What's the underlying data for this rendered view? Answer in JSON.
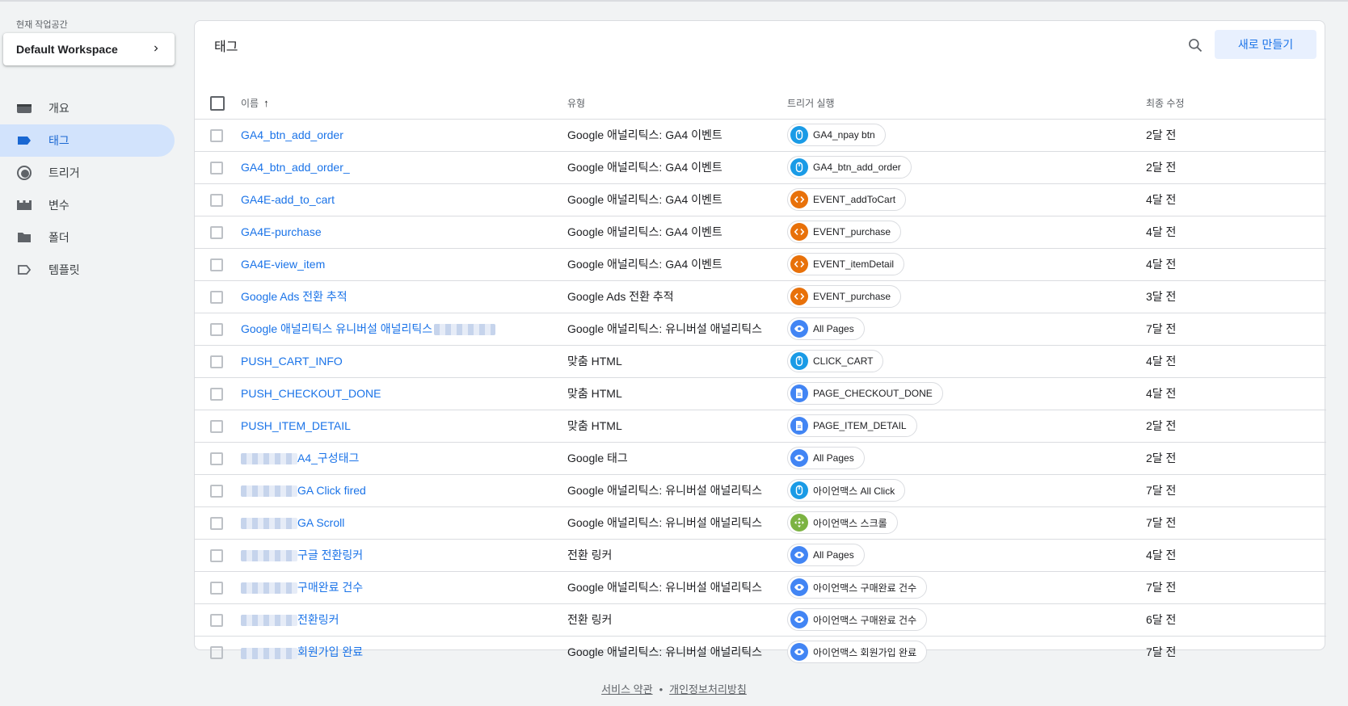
{
  "workspace": {
    "label": "현재 작업공간",
    "name": "Default Workspace"
  },
  "nav": {
    "overview": "개요",
    "tags": "태그",
    "triggers": "트리거",
    "variables": "변수",
    "folders": "폴더",
    "templates": "템플릿"
  },
  "card": {
    "title": "태그",
    "new_button": "새로 만들기"
  },
  "columns": {
    "name": "이름",
    "type": "유형",
    "trigger": "트리거 실행",
    "modified": "최종 수정"
  },
  "colors": {
    "accent": "#1a73e8",
    "cursor_icon": "#1a9be6",
    "code_icon": "#e8710a",
    "eye_icon": "#4285f4",
    "doc_icon": "#4285f4",
    "scroll_icon": "#7cb342"
  },
  "rows": [
    {
      "name": "GA4_btn_add_order",
      "type": "Google 애널리틱스: GA4 이벤트",
      "trigger": "GA4_npay btn",
      "trigger_icon": "cursor-icon",
      "modified": "2달 전"
    },
    {
      "name": "GA4_btn_add_order_",
      "type": "Google 애널리틱스: GA4 이벤트",
      "trigger": "GA4_btn_add_order",
      "trigger_icon": "cursor-icon",
      "modified": "2달 전"
    },
    {
      "name": "GA4E-add_to_cart",
      "type": "Google 애널리틱스: GA4 이벤트",
      "trigger": "EVENT_addToCart",
      "trigger_icon": "code-icon",
      "modified": "4달 전"
    },
    {
      "name": "GA4E-purchase",
      "type": "Google 애널리틱스: GA4 이벤트",
      "trigger": "EVENT_purchase",
      "trigger_icon": "code-icon",
      "modified": "4달 전"
    },
    {
      "name": "GA4E-view_item",
      "type": "Google 애널리틱스: GA4 이벤트",
      "trigger": "EVENT_itemDetail",
      "trigger_icon": "code-icon",
      "modified": "4달 전"
    },
    {
      "name": "Google Ads 전환 추적",
      "type": "Google Ads 전환 추적",
      "trigger": "EVENT_purchase",
      "trigger_icon": "code-icon",
      "modified": "3달 전"
    },
    {
      "name": "Google 애널리틱스 유니버설 애널리틱스",
      "type": "Google 애널리틱스: 유니버설 애널리틱스",
      "trigger": "All Pages",
      "trigger_icon": "eye-icon",
      "modified": "7달 전"
    },
    {
      "name": "PUSH_CART_INFO",
      "type": "맞춤 HTML",
      "trigger": "CLICK_CART",
      "trigger_icon": "cursor-icon",
      "modified": "4달 전"
    },
    {
      "name": "PUSH_CHECKOUT_DONE",
      "type": "맞춤 HTML",
      "trigger": "PAGE_CHECKOUT_DONE",
      "trigger_icon": "doc-icon",
      "modified": "4달 전"
    },
    {
      "name": "PUSH_ITEM_DETAIL",
      "type": "맞춤 HTML",
      "trigger": "PAGE_ITEM_DETAIL",
      "trigger_icon": "doc-icon",
      "modified": "2달 전"
    },
    {
      "name": "A4_구성태그",
      "type": "Google 태그",
      "trigger": "All Pages",
      "trigger_icon": "eye-icon",
      "modified": "2달 전"
    },
    {
      "name": "GA Click fired",
      "type": "Google 애널리틱스: 유니버설 애널리틱스",
      "trigger": "아이언맥스 All Click",
      "trigger_icon": "cursor-icon",
      "modified": "7달 전"
    },
    {
      "name": "GA Scroll",
      "type": "Google 애널리틱스: 유니버설 애널리틱스",
      "trigger": "아이언맥스 스크롤",
      "trigger_icon": "scroll-icon",
      "modified": "7달 전"
    },
    {
      "name": "구글 전환링커",
      "type": "전환 링커",
      "trigger": "All Pages",
      "trigger_icon": "eye-icon",
      "modified": "4달 전"
    },
    {
      "name": "구매완료 건수",
      "type": "Google 애널리틱스: 유니버설 애널리틱스",
      "trigger": "아이언맥스 구매완료 건수",
      "trigger_icon": "eye-icon",
      "modified": "7달 전"
    },
    {
      "name": "전환링커",
      "type": "전환 링커",
      "trigger": "아이언맥스 구매완료 건수",
      "trigger_icon": "eye-icon",
      "modified": "6달 전"
    },
    {
      "name": "회원가입 완료",
      "type": "Google 애널리틱스: 유니버설 애널리틱스",
      "trigger": "아이언맥스 회원가입 완료",
      "trigger_icon": "eye-icon",
      "modified": "7달 전"
    }
  ],
  "footer": {
    "terms": "서비스 약관",
    "separator": "•",
    "privacy": "개인정보처리방침"
  }
}
